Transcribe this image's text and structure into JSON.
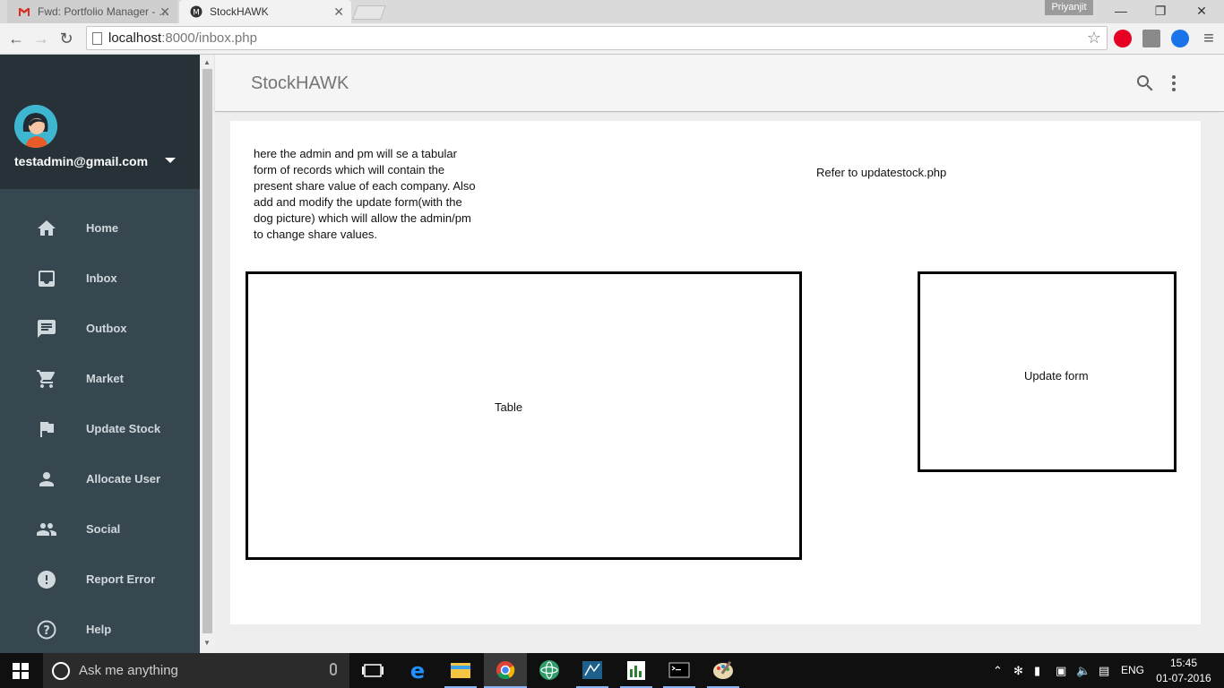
{
  "browser": {
    "tabs": [
      {
        "title": "Fwd: Portfolio Manager - …",
        "active": false
      },
      {
        "title": "StockHAWK",
        "active": true
      }
    ],
    "profile_name": "Priyanjit",
    "url_host": "localhost",
    "url_rest": ":8000/inbox.php",
    "window_controls": [
      "minimize-icon",
      "restore-icon",
      "close-icon"
    ],
    "close_glyph": "✕"
  },
  "sidebar": {
    "user_email": "testadmin@gmail.com",
    "items": [
      {
        "label": "Home",
        "icon": "home-icon"
      },
      {
        "label": "Inbox",
        "icon": "inbox-icon"
      },
      {
        "label": "Outbox",
        "icon": "outbox-icon"
      },
      {
        "label": "Market",
        "icon": "cart-icon"
      },
      {
        "label": "Update Stock",
        "icon": "flag-icon"
      },
      {
        "label": "Allocate User",
        "icon": "person-icon"
      },
      {
        "label": "Social",
        "icon": "people-icon"
      },
      {
        "label": "Report Error",
        "icon": "error-icon"
      },
      {
        "label": "Help",
        "icon": "help-icon"
      }
    ]
  },
  "header": {
    "title": "StockHAWK"
  },
  "main": {
    "note": "here the admin and pm will se a tabular form of records which will contain the present share value of each company. Also add and modify the update form(with the dog picture) which will allow the admin/pm to change share values.",
    "ref_note": "Refer to updatestock.php",
    "table_label": "Table",
    "form_label": "Update form"
  },
  "taskbar": {
    "search_placeholder": "Ask me anything",
    "language": "ENG",
    "time": "15:45",
    "date": "01-07-2016"
  },
  "colors": {
    "sidebar_bg": "#37474f",
    "sidebar_header_bg": "#263238",
    "appbar_bg": "#f5f5f5",
    "content_bg": "#eeeeee"
  }
}
